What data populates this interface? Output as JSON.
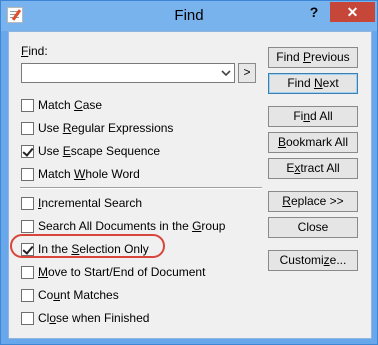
{
  "window": {
    "title": "Find",
    "help_label": "?",
    "close_label": "✕"
  },
  "find": {
    "label_underlined": "F",
    "label_rest": "ind:",
    "value": "",
    "next_button": ">"
  },
  "options": [
    {
      "pre": "Match ",
      "u": "C",
      "post": "ase",
      "checked": false
    },
    {
      "pre": "Use ",
      "u": "R",
      "post": "egular Expressions",
      "checked": false
    },
    {
      "pre": "Use ",
      "u": "E",
      "post": "scape Sequence",
      "checked": true
    },
    {
      "pre": "Match ",
      "u": "W",
      "post": "hole Word",
      "checked": false
    },
    {
      "pre": "",
      "u": "I",
      "post": "ncremental Search",
      "checked": false
    },
    {
      "pre": "Search All Documents in the ",
      "u": "G",
      "post": "roup",
      "checked": false
    },
    {
      "pre": "In the ",
      "u": "S",
      "post": "election Only",
      "checked": true
    },
    {
      "pre": "",
      "u": "M",
      "post": "ove to Start/End of Document",
      "checked": false
    },
    {
      "pre": "Co",
      "u": "u",
      "post": "nt Matches",
      "checked": false
    },
    {
      "pre": "Cl",
      "u": "o",
      "post": "se when Finished",
      "checked": false
    }
  ],
  "buttons": [
    {
      "pre": "Find ",
      "u": "P",
      "post": "revious"
    },
    {
      "pre": "Find ",
      "u": "N",
      "post": "ext"
    },
    {
      "pre": "Fi",
      "u": "n",
      "post": "d All"
    },
    {
      "pre": "",
      "u": "B",
      "post": "ookmark All"
    },
    {
      "pre": "E",
      "u": "x",
      "post": "tract All"
    },
    {
      "pre": "",
      "u": "R",
      "post": "eplace >>"
    },
    {
      "pre": "",
      "u": "",
      "post": "Close"
    },
    {
      "pre": "Customi",
      "u": "z",
      "post": "e..."
    }
  ],
  "colors": {
    "titlebar": "#78b3ee",
    "close_button": "#c7463a",
    "highlight_ring": "#d8453a"
  }
}
